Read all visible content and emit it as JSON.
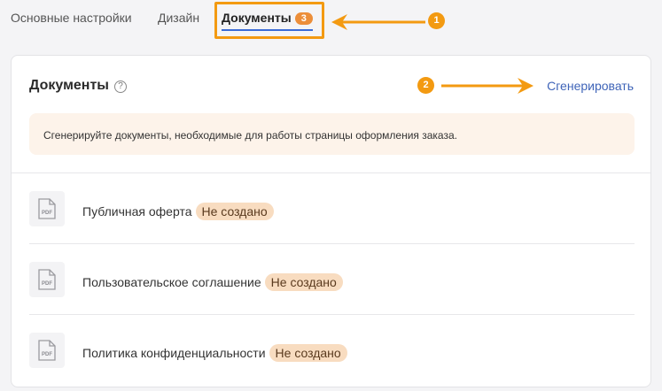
{
  "tabs": [
    {
      "label": "Основные настройки"
    },
    {
      "label": "Дизайн"
    },
    {
      "label": "Документы",
      "badge": "3"
    }
  ],
  "card": {
    "title": "Документы",
    "help_icon": "?",
    "generate_label": "Сгенерировать",
    "notice": "Сгенерируйте документы, необходимые для работы страницы оформления заказа."
  },
  "documents": [
    {
      "name": "Публичная оферта",
      "status": "Не создано",
      "icon": "pdf-file-icon",
      "icon_text": "PDF"
    },
    {
      "name": "Пользовательское соглашение",
      "status": "Не создано",
      "icon": "pdf-file-icon",
      "icon_text": "PDF"
    },
    {
      "name": "Политика конфиденциальности",
      "status": "Не создано",
      "icon": "pdf-file-icon",
      "icon_text": "PDF"
    }
  ],
  "annotations": {
    "marker_1": "1",
    "marker_2": "2",
    "color": "#f39a11"
  },
  "colors": {
    "accent_blue": "#3f64b8",
    "badge_orange": "#ec8e39",
    "status_bg": "#f8dcc0",
    "notice_bg": "#fdf3ea"
  }
}
